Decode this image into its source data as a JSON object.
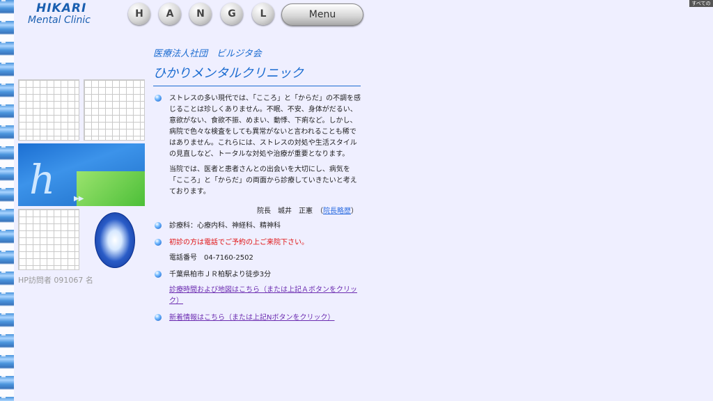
{
  "logo": {
    "line1": "HIKARI",
    "line2": "Mental Clinic"
  },
  "nav": {
    "buttons": [
      "H",
      "A",
      "N",
      "G",
      "L"
    ],
    "menu_label": "Menu"
  },
  "corner_tag": "すべての",
  "sidebar": {
    "visitor_counter": "HP訪問者 091067 名",
    "banner_letter": "h",
    "banner_arrows": "▶▶"
  },
  "main": {
    "corp_name": "医療法人社団　ビルジタ会",
    "clinic_name": "ひかりメンタルクリニック",
    "intro_para1": "ストレスの多い現代では、「こころ」と「からだ」の不調を感じることは珍しくありません。不眠、不安、身体がだるい、意欲がない、食欲不振、めまい、動悸、下痢など。しかし、病院で色々な検査をしても異常がないと言われることも稀ではありません。これらには、ストレスの対処や生活スタイルの見直しなど、トータルな対処や治療が重要となります。",
    "intro_para2": "当院では、医者と患者さんとの出会いを大切にし、病気を「こころ」と「からだ」の両面から診療していきたいと考えております。",
    "director": "院長　城井　正憲　（",
    "director_link": "院長略歴",
    "director_close": "）",
    "departments": "診療科：心療内科、神経科、精神科",
    "first_visit": "初診の方は電話でご予約の上ご来院下さい。",
    "phone": "電話番号　04-7160-2502",
    "access": "千葉県柏市ＪＲ柏駅より徒歩3分",
    "hours_link": "診療時間および地図はこちら（または上記Ａボタンをクリック）",
    "news_link": "新着情報はこちら（または上記Nボタンをクリック）"
  }
}
